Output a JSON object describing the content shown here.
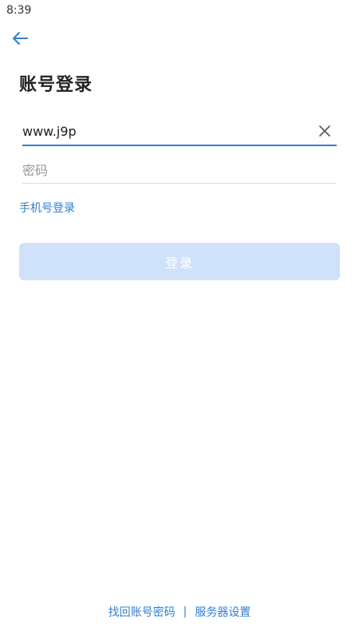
{
  "status_bar": {
    "time": "8:39"
  },
  "header": {
    "title": "账号登录"
  },
  "form": {
    "account_value": "www.j9p",
    "password_placeholder": "密码"
  },
  "links": {
    "phone_login": "手机号登录"
  },
  "login_button": {
    "label": "登录"
  },
  "footer": {
    "recover_account": "找回账号密码",
    "separator": "|",
    "server_settings": "服务器设置"
  },
  "colors": {
    "accent": "#2f7fd0",
    "button_disabled": "#cfe2fa"
  },
  "icons": {
    "back": "arrow-left-icon",
    "clear": "close-icon"
  }
}
